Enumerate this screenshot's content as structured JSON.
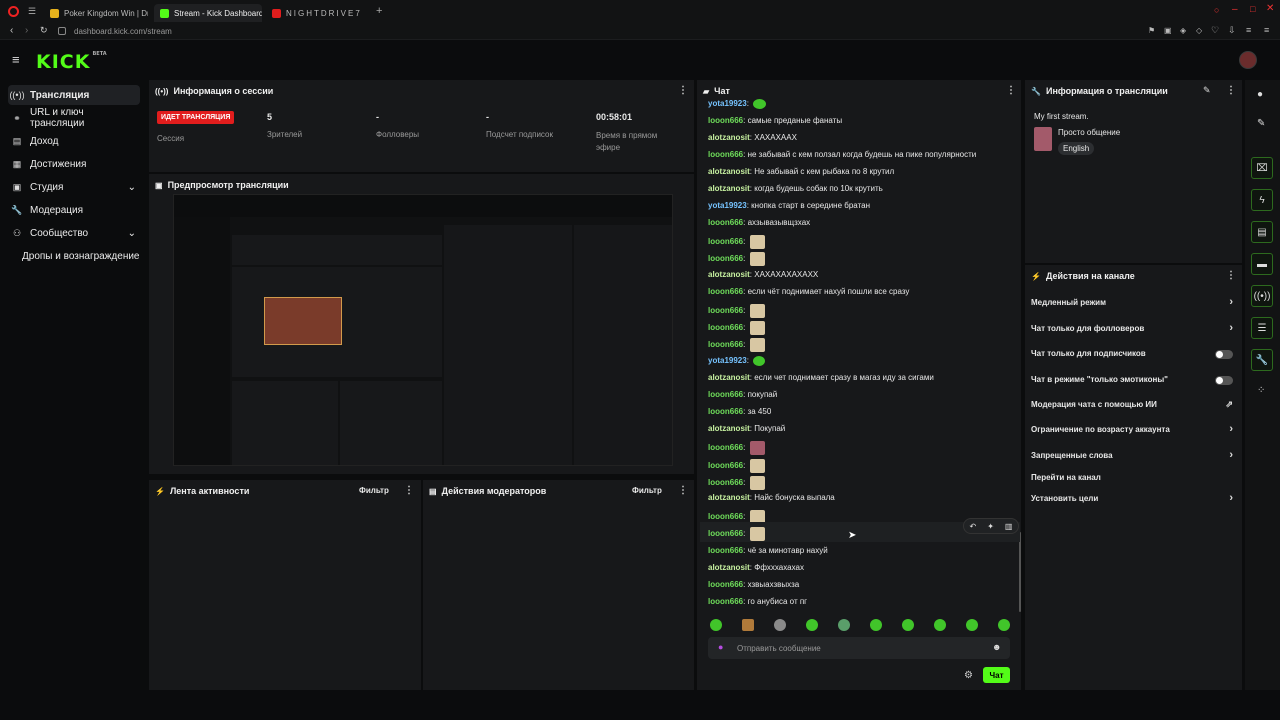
{
  "browser": {
    "tabs": [
      {
        "label": "Poker Kingdom Win | Drag"
      },
      {
        "label": "Stream - Kick Dashboard"
      },
      {
        "label": "NIGHTDRIVE7"
      }
    ],
    "url": "dashboard.kick.com/stream"
  },
  "app": {
    "logo": "KICK",
    "logo_badge": "BETA"
  },
  "sidebar": {
    "items": [
      {
        "label": "Трансляция",
        "icon": "broadcast-icon"
      },
      {
        "label": "URL и ключ трансляции",
        "icon": "link-icon"
      },
      {
        "label": "Доход",
        "icon": "money-icon"
      },
      {
        "label": "Достижения",
        "icon": "trophy-icon"
      },
      {
        "label": "Студия",
        "icon": "studio-icon"
      },
      {
        "label": "Модерация",
        "icon": "wrench-icon"
      },
      {
        "label": "Сообщество",
        "icon": "community-icon"
      },
      {
        "label": "Дропы и вознаграждение",
        "icon": ""
      }
    ]
  },
  "session": {
    "title": "Информация о сессии",
    "live_badge": "ИДЕТ ТРАНСЛЯЦИЯ",
    "live_label": "Сессия",
    "viewers_value": "5",
    "viewers_label": "Зрителей",
    "followers_value": "-",
    "followers_label": "Фолловеры",
    "subs_value": "-",
    "subs_label": "Подсчет подписок",
    "uptime_value": "00:58:01",
    "uptime_label": "Время в прямом эфире"
  },
  "preview": {
    "title": "Предпросмотр трансляции"
  },
  "activity": {
    "title": "Лента активности",
    "filter": "Фильтр"
  },
  "modactions": {
    "title": "Действия модераторов",
    "filter": "Фильтр"
  },
  "chat": {
    "title": "Чат",
    "messages": [
      {
        "user": "yota19923",
        "text": "",
        "emote": true
      },
      {
        "user": "looon666",
        "text": "самые преданые фанаты"
      },
      {
        "user": "alotzanosit",
        "text": "ХАХАХААХ"
      },
      {
        "user": "looon666",
        "text": "не забывай с кем ползал когда будешь на пике популярности"
      },
      {
        "user": "alotzanosit",
        "text": "Не забывай с кем рыбака по 8 крутил"
      },
      {
        "user": "alotzanosit",
        "text": "когда будешь собак по 10к крутить"
      },
      {
        "user": "yota19923",
        "text": "кнопка старт в середине братан"
      },
      {
        "user": "looon666",
        "text": "ахзывазывщзхах"
      },
      {
        "user": "looon666",
        "text": "",
        "emote": true
      },
      {
        "user": "looon666",
        "text": "",
        "emote": true
      },
      {
        "user": "alotzanosit",
        "text": "ХАХАХАХАХАХХ"
      },
      {
        "user": "looon666",
        "text": "если чёт поднимает нахуй пошли все сразу"
      },
      {
        "user": "looon666",
        "text": "",
        "emote": true
      },
      {
        "user": "looon666",
        "text": "",
        "emote": true
      },
      {
        "user": "looon666",
        "text": "",
        "emote": true
      },
      {
        "user": "yota19923",
        "text": "",
        "emote": true
      },
      {
        "user": "alotzanosit",
        "text": "если чет поднимает сразу в магаз иду за сигами"
      },
      {
        "user": "looon666",
        "text": "покупай"
      },
      {
        "user": "looon666",
        "text": "за 450"
      },
      {
        "user": "alotzanosit",
        "text": "Покупай"
      },
      {
        "user": "looon666",
        "text": "",
        "emote": true
      },
      {
        "user": "looon666",
        "text": "",
        "emote": true
      },
      {
        "user": "looon666",
        "text": "",
        "emote": true
      },
      {
        "user": "alotzanosit",
        "text": "Найс бонуска выпала"
      },
      {
        "user": "looon666",
        "text": "",
        "emote": true
      },
      {
        "user": "looon666",
        "text": "",
        "emote": true
      },
      {
        "user": "looon666",
        "text": "чё за минотавр нахуй"
      },
      {
        "user": "alotzanosit",
        "text": "Ффхххахахах"
      },
      {
        "user": "looon666",
        "text": "хзвыахзвыхза"
      },
      {
        "user": "looon666",
        "text": "го анубиса от пг"
      }
    ],
    "input_placeholder": "Отправить сообщение",
    "send_label": "Чат"
  },
  "streaminfo": {
    "title": "Информация о трансляции",
    "stream_title": "My first stream.",
    "category": "Просто общение",
    "language": "English"
  },
  "channel_actions": {
    "title": "Действия на канале",
    "items": [
      {
        "label": "Медленный режим",
        "control": "arrow"
      },
      {
        "label": "Чат только для фолловеров",
        "control": "arrow"
      },
      {
        "label": "Чат только для подписчиков",
        "control": "toggle"
      },
      {
        "label": "Чат в режиме \"только эмотиконы\"",
        "control": "toggle"
      },
      {
        "label": "Модерация чата с помощью ИИ",
        "control": "external"
      },
      {
        "label": "Ограничение по возрасту аккаунта",
        "control": "arrow"
      },
      {
        "label": "Запрещенные слова",
        "control": "arrow"
      },
      {
        "label": "Перейти на канал",
        "control": "none"
      },
      {
        "label": "Установить цели",
        "control": "arrow"
      }
    ]
  },
  "colors": {
    "accent": "#53fc18",
    "live": "#e11d1d",
    "panel": "#17181a"
  }
}
